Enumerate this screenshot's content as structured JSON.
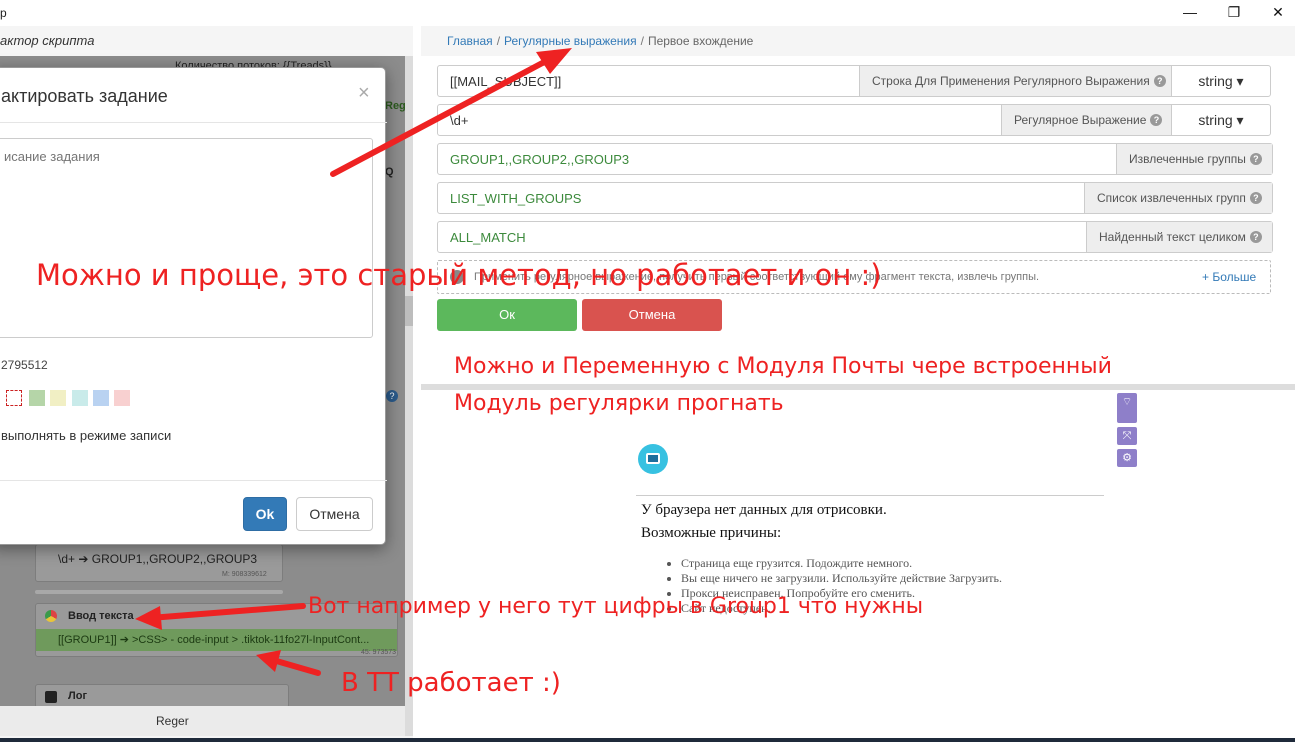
{
  "window": {
    "title": "р",
    "minimize": "—",
    "maximize": "❐",
    "close": "✕"
  },
  "left_panel": {
    "caption": "актор скрипта",
    "bg_threads": "Количество потоков: {{Treads}}",
    "bg_reg": "Reg",
    "bg_search": "Q",
    "bg_help": "?",
    "bg_regex_node": "\\d+ ➔ GROUP1,,GROUP2,,GROUP3",
    "bg_node_id_1": "М: 908339612",
    "bg_input_title": "Ввод текста",
    "bg_input_node": "[[GROUP1]] ➔ >CSS> - code-input > .tiktok-11fo27l-InputCont...",
    "bg_node_id_2": "45: 973573",
    "bg_log_title": "Лог",
    "bottom_label": "Reger"
  },
  "modal": {
    "title": "актировать задание",
    "close": "×",
    "description_placeholder": "исание задания",
    "number": "2795512",
    "record_mode_label": "выполнять в режиме записи",
    "ok": "Ok",
    "cancel": "Отмена",
    "swatches": [
      "#ffffff",
      "#b5d5a8",
      "#f1efc4",
      "#c9ebea",
      "#b9d2f1",
      "#f8d0d0"
    ]
  },
  "right_panel": {
    "breadcrumb": [
      "Главная",
      "Регулярные выражения",
      "Первое вхождение"
    ],
    "rows": [
      {
        "value": "[[MAIL_SUBJECT]]",
        "label": "Строка Для Применения Регулярного Выражения",
        "dropdown": "string ▾"
      },
      {
        "value": "\\d+",
        "label": "Регулярное Выражение",
        "dropdown": "string ▾"
      },
      {
        "value": "GROUP1,,GROUP2,,GROUP3",
        "label": "Извлеченные группы"
      },
      {
        "value": "LIST_WITH_GROUPS",
        "label": "Список извлеченных групп"
      },
      {
        "value": "ALL_MATCH",
        "label": "Найденный текст целиком"
      }
    ],
    "hint": "Применить регулярное выражение, получить первый соответствующий ему фрагмент текста, извлечь группы.",
    "more": "+ Больше",
    "ok": "Ок",
    "cancel": "Отмена",
    "browser": {
      "no_data": "У браузера нет данных для отрисовки.",
      "reasons_title": "Возможные причины:",
      "reasons": [
        "Страница еще грузится. Подождите немного.",
        "Вы еще ничего не загрузили. Используйте действие Загрузить.",
        "Прокси неисправен. Попробуйте его сменить.",
        "Сайт недоступен."
      ]
    }
  },
  "annotations": {
    "a1": "Можно и проще, это старый метод, но работает и он :)",
    "a2_line1": "Можно и Переменную с Модуля Почты чере встроенный",
    "a2_line2": "Модуль регулярки прогнать",
    "a3": "Вот например у него тут цифры в Group1 что нужны",
    "a4": "В ТТ работает :)"
  }
}
